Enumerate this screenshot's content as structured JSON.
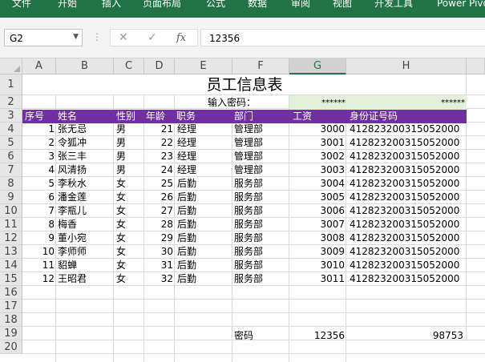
{
  "ribbon": {
    "tabs": [
      "文件",
      "开始",
      "插入",
      "页面布局",
      "公式",
      "数据",
      "审阅",
      "视图",
      "开发工具",
      "Power Pivot"
    ]
  },
  "formula_bar": {
    "name_box": "G2",
    "cancel_icon": "✕",
    "enter_icon": "✓",
    "fx_icon": "fx",
    "formula": "12356"
  },
  "columns": [
    "A",
    "B",
    "C",
    "D",
    "E",
    "F",
    "G",
    "H"
  ],
  "rows": [
    "1",
    "2",
    "3",
    "4",
    "5",
    "6",
    "7",
    "8",
    "9",
    "10",
    "11",
    "12",
    "13",
    "14",
    "15",
    "16",
    "17",
    "18",
    "19",
    "20"
  ],
  "sheet": {
    "title": "员工信息表",
    "password_label": "输入密码：",
    "password_mask_g": "******",
    "password_mask_h": "******",
    "headers": [
      "序号",
      "姓名",
      "性别",
      "年龄",
      "职务",
      "部门",
      "工资",
      "身份证号码"
    ],
    "records": [
      {
        "no": "1",
        "name": "张无忌",
        "gender": "男",
        "age": "21",
        "title": "经理",
        "dept": "管理部",
        "salary": "3000",
        "id": "412823200315052000"
      },
      {
        "no": "2",
        "name": "令狐冲",
        "gender": "男",
        "age": "22",
        "title": "经理",
        "dept": "管理部",
        "salary": "3001",
        "id": "412823200315052000"
      },
      {
        "no": "3",
        "name": "张三丰",
        "gender": "男",
        "age": "23",
        "title": "经理",
        "dept": "管理部",
        "salary": "3002",
        "id": "412823200315052000"
      },
      {
        "no": "4",
        "name": "风清扬",
        "gender": "男",
        "age": "24",
        "title": "经理",
        "dept": "管理部",
        "salary": "3003",
        "id": "412823200315052000"
      },
      {
        "no": "5",
        "name": "李秋水",
        "gender": "女",
        "age": "25",
        "title": "后勤",
        "dept": "服务部",
        "salary": "3004",
        "id": "412823200315052000"
      },
      {
        "no": "6",
        "name": "潘金莲",
        "gender": "女",
        "age": "26",
        "title": "后勤",
        "dept": "服务部",
        "salary": "3005",
        "id": "412823200315052000"
      },
      {
        "no": "7",
        "name": "李瓶儿",
        "gender": "女",
        "age": "27",
        "title": "后勤",
        "dept": "服务部",
        "salary": "3006",
        "id": "412823200315052000"
      },
      {
        "no": "8",
        "name": "梅香",
        "gender": "女",
        "age": "28",
        "title": "后勤",
        "dept": "服务部",
        "salary": "3007",
        "id": "412823200315052000"
      },
      {
        "no": "9",
        "name": "董小宛",
        "gender": "女",
        "age": "29",
        "title": "后勤",
        "dept": "服务部",
        "salary": "3008",
        "id": "412823200315052000"
      },
      {
        "no": "10",
        "name": "李师师",
        "gender": "女",
        "age": "30",
        "title": "后勤",
        "dept": "服务部",
        "salary": "3009",
        "id": "412823200315052000"
      },
      {
        "no": "11",
        "name": "貂蝉",
        "gender": "女",
        "age": "31",
        "title": "后勤",
        "dept": "服务部",
        "salary": "3010",
        "id": "412823200315052000"
      },
      {
        "no": "12",
        "name": "王昭君",
        "gender": "女",
        "age": "32",
        "title": "后勤",
        "dept": "服务部",
        "salary": "3011",
        "id": "412823200315052000"
      }
    ],
    "row19": {
      "label": "密码",
      "value": "12356",
      "h_value": "98753"
    }
  },
  "colors": {
    "ribbon": "#217346",
    "header_band": "#7030a0",
    "password_fill": "#e2efda"
  }
}
